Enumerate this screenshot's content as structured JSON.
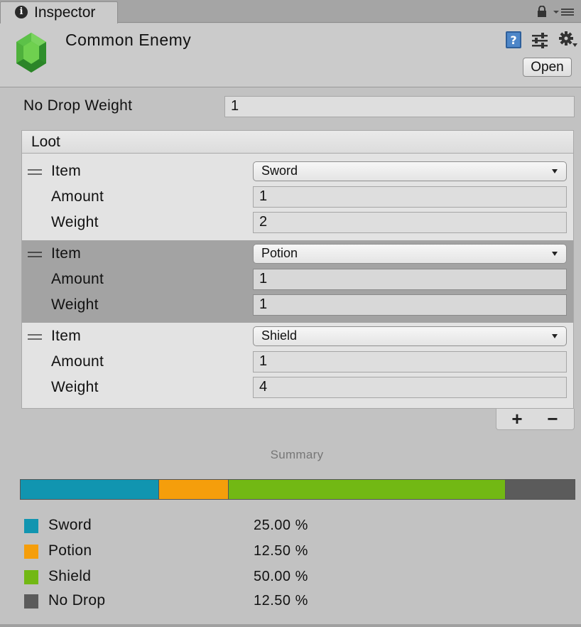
{
  "tab": {
    "title": "Inspector",
    "icon": "info-icon"
  },
  "header": {
    "object_name": "Common Enemy",
    "open_label": "Open",
    "icon": "green-gem-icon"
  },
  "no_drop": {
    "label": "No Drop Weight",
    "value": "1"
  },
  "loot": {
    "title": "Loot",
    "items": [
      {
        "item_label": "Item",
        "item_value": "Sword",
        "amount_label": "Amount",
        "amount_value": "1",
        "weight_label": "Weight",
        "weight_value": "2",
        "selected": false
      },
      {
        "item_label": "Item",
        "item_value": "Potion",
        "amount_label": "Amount",
        "amount_value": "1",
        "weight_label": "Weight",
        "weight_value": "1",
        "selected": true
      },
      {
        "item_label": "Item",
        "item_value": "Shield",
        "amount_label": "Amount",
        "amount_value": "1",
        "weight_label": "Weight",
        "weight_value": "4",
        "selected": false
      }
    ],
    "add_label": "+",
    "remove_label": "−"
  },
  "summary": {
    "title": "Summary",
    "entries": [
      {
        "name": "Sword",
        "percent_label": "25.00 %",
        "fraction": 0.25,
        "color": "#1195b0"
      },
      {
        "name": "Potion",
        "percent_label": "12.50 %",
        "fraction": 0.125,
        "color": "#f59e0b"
      },
      {
        "name": "Shield",
        "percent_label": "50.00 %",
        "fraction": 0.5,
        "color": "#72b814"
      },
      {
        "name": "No Drop",
        "percent_label": "12.50 %",
        "fraction": 0.125,
        "color": "#5b5b5b"
      }
    ]
  }
}
